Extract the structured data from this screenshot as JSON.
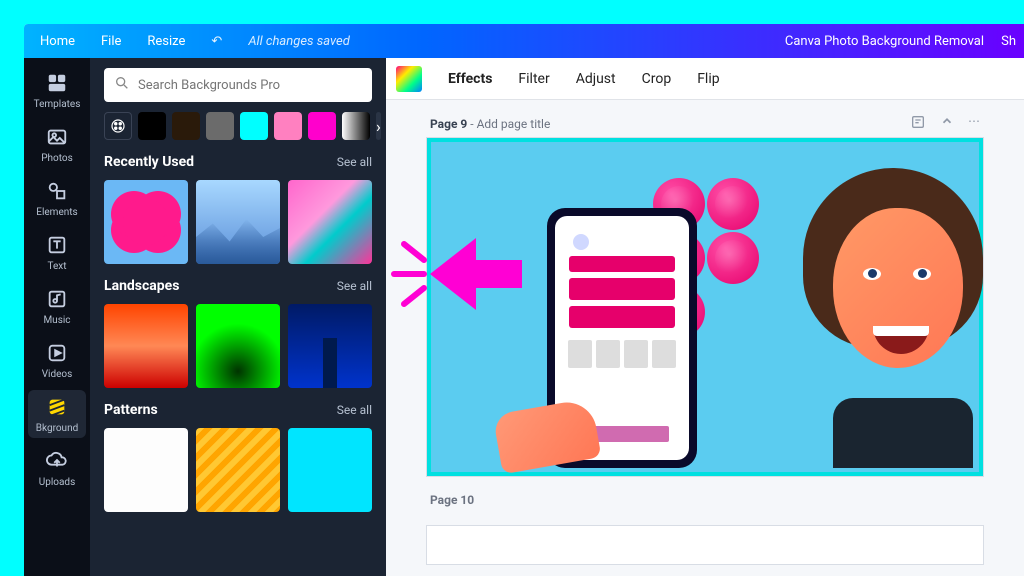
{
  "menu": {
    "home": "Home",
    "file": "File",
    "resize": "Resize",
    "saved": "All changes saved",
    "title": "Canva Photo Background Removal",
    "share": "Sh"
  },
  "sidebar": {
    "items": [
      {
        "label": "Templates"
      },
      {
        "label": "Photos"
      },
      {
        "label": "Elements"
      },
      {
        "label": "Text"
      },
      {
        "label": "Music"
      },
      {
        "label": "Videos"
      },
      {
        "label": "Bkground"
      },
      {
        "label": "Uploads"
      }
    ]
  },
  "search": {
    "placeholder": "Search Backgrounds Pro"
  },
  "swatches": [
    "#000000",
    "#2a1a0a",
    "#6b6b6b",
    "#00ffff",
    "#ff80c0",
    "#ff00cc",
    "gradient"
  ],
  "sections": {
    "recent": {
      "title": "Recently Used",
      "see": "See all"
    },
    "landscapes": {
      "title": "Landscapes",
      "see": "See all"
    },
    "patterns": {
      "title": "Patterns",
      "see": "See all"
    }
  },
  "toolbar": {
    "effects": "Effects",
    "filter": "Filter",
    "adjust": "Adjust",
    "crop": "Crop",
    "flip": "Flip"
  },
  "page": {
    "current_label": "Page 9",
    "sep": " - ",
    "placeholder": "Add page title",
    "next_label": "Page 10",
    "number": 9
  },
  "colors": {
    "accent_cyan": "#00ffff",
    "annotation_arrow": "#ff00d4"
  }
}
